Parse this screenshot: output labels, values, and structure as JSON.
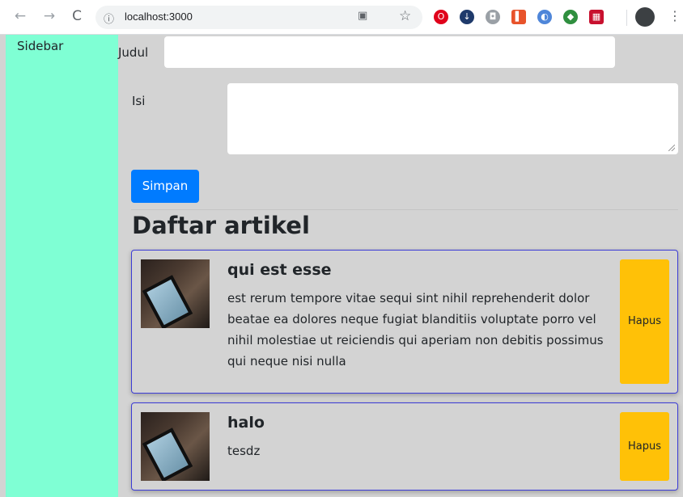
{
  "browser": {
    "url": "localhost:3000",
    "icons": [
      "back-icon",
      "forward-icon",
      "reload-icon",
      "info-icon",
      "translate-icon",
      "star-icon",
      "kebab-menu-icon"
    ]
  },
  "sidebar": {
    "label": "Sidebar"
  },
  "form": {
    "judul_label": "Judul",
    "judul_value": "",
    "isi_label": "Isi",
    "isi_value": "",
    "submit_label": "Simpan"
  },
  "list": {
    "heading": "Daftar artikel",
    "articles": [
      {
        "title": "qui est esse",
        "body": "est rerum tempore vitae sequi sint nihil reprehenderit dolor beatae ea dolores neque fugiat blanditiis voluptate porro vel nihil molestiae ut reiciendis qui aperiam non debitis possimus qui neque nisi nulla",
        "delete_label": "Hapus"
      },
      {
        "title": "halo",
        "body": "tesdz",
        "delete_label": "Hapus"
      }
    ]
  },
  "colors": {
    "sidebar": "#7fffd4",
    "primary": "#007bff",
    "warning": "#ffc107",
    "card_border": "#3b3bd6",
    "background": "#d3d3d3"
  }
}
